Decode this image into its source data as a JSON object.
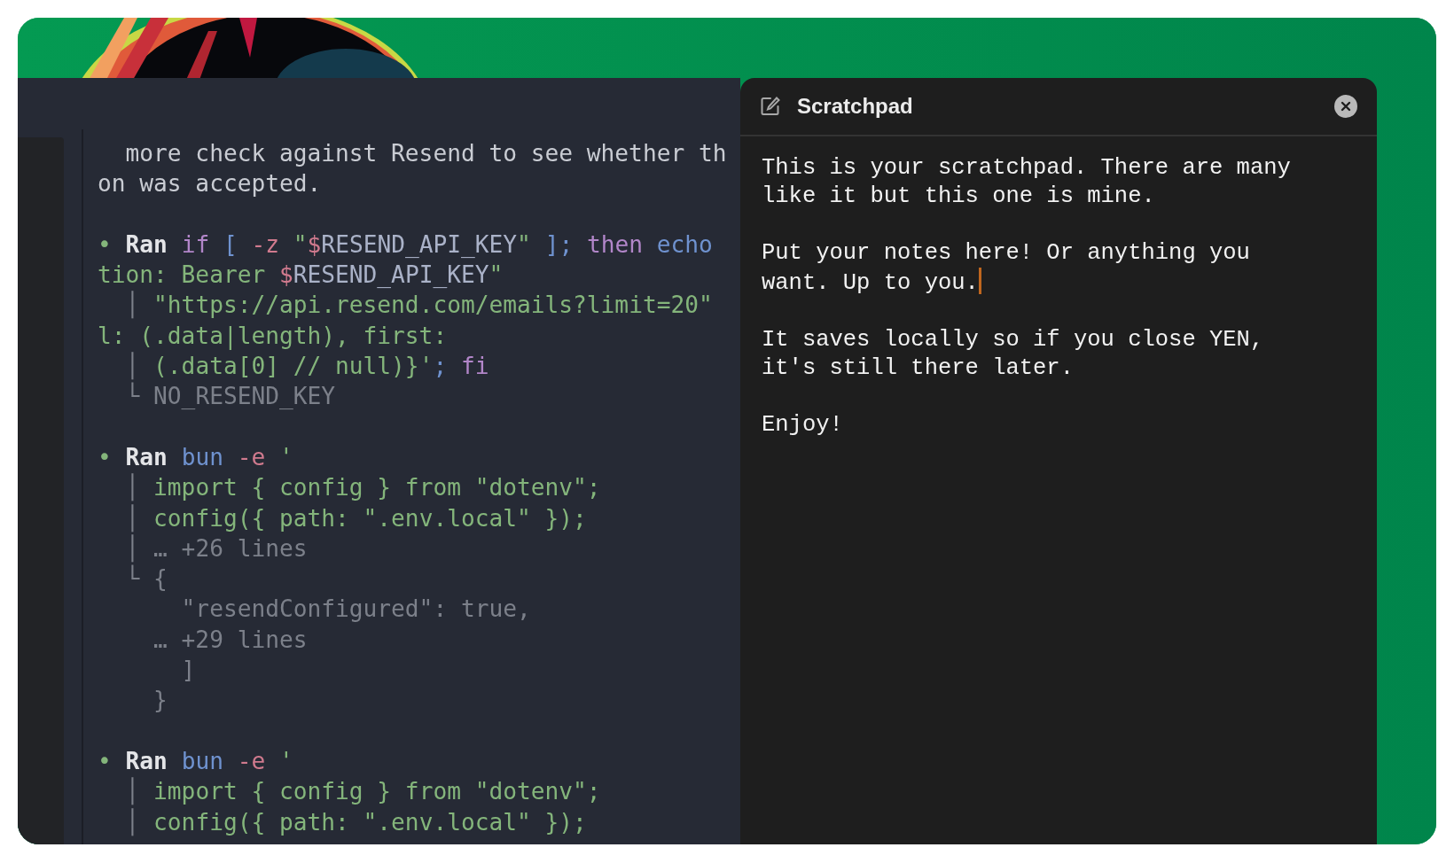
{
  "terminal": {
    "blocks": [
      {
        "lines": [
          {
            "segments": [
              {
                "text": "  more check against Resend to see whether th",
                "kind": "plain"
              }
            ]
          },
          {
            "segments": [
              {
                "text": "on was accepted.",
                "kind": "plain"
              }
            ]
          }
        ]
      },
      {
        "lines": [
          {
            "segments": [
              {
                "text": "• ",
                "kind": "bullet"
              },
              {
                "text": "Ran ",
                "kind": "bold"
              },
              {
                "text": "if ",
                "kind": "keyword"
              },
              {
                "text": "[ ",
                "kind": "builtin"
              },
              {
                "text": "-z ",
                "kind": "flag"
              },
              {
                "text": "\"",
                "kind": "string"
              },
              {
                "text": "$",
                "kind": "flag"
              },
              {
                "text": "RESEND_API_KEY",
                "kind": "variable"
              },
              {
                "text": "\" ",
                "kind": "string"
              },
              {
                "text": "]",
                "kind": "builtin"
              },
              {
                "text": "; ",
                "kind": "builtin"
              },
              {
                "text": "then ",
                "kind": "keyword"
              },
              {
                "text": "echo",
                "kind": "builtin"
              }
            ]
          },
          {
            "segments": [
              {
                "text": "tion: Bearer ",
                "kind": "string"
              },
              {
                "text": "$",
                "kind": "flag"
              },
              {
                "text": "RESEND_API_KEY",
                "kind": "variable"
              },
              {
                "text": "\"",
                "kind": "string"
              }
            ]
          },
          {
            "segments": [
              {
                "text": "  │ ",
                "kind": "gutter"
              },
              {
                "text": "\"https://api.resend.com/emails?limit=20\"",
                "kind": "string"
              }
            ]
          },
          {
            "segments": [
              {
                "text": "l: (.data|length), first:",
                "kind": "string"
              }
            ]
          },
          {
            "segments": [
              {
                "text": "  │ ",
                "kind": "gutter"
              },
              {
                "text": "(.data[0] // null)}'",
                "kind": "string"
              },
              {
                "text": "; ",
                "kind": "builtin"
              },
              {
                "text": "fi",
                "kind": "keyword"
              }
            ]
          },
          {
            "segments": [
              {
                "text": "  └ ",
                "kind": "gutter"
              },
              {
                "text": "NO_RESEND_KEY",
                "kind": "dim"
              }
            ]
          }
        ]
      },
      {
        "lines": [
          {
            "segments": [
              {
                "text": "• ",
                "kind": "bullet"
              },
              {
                "text": "Ran ",
                "kind": "bold"
              },
              {
                "text": "bun ",
                "kind": "builtin"
              },
              {
                "text": "-e ",
                "kind": "flag"
              },
              {
                "text": "'",
                "kind": "string"
              }
            ]
          },
          {
            "segments": [
              {
                "text": "  │ ",
                "kind": "gutter"
              },
              {
                "text": "import { config } from \"dotenv\";",
                "kind": "string"
              }
            ]
          },
          {
            "segments": [
              {
                "text": "  │ ",
                "kind": "gutter"
              },
              {
                "text": "config({ path: \".env.local\" });",
                "kind": "string"
              }
            ]
          },
          {
            "segments": [
              {
                "text": "  │ ",
                "kind": "gutter"
              },
              {
                "text": "… +26 lines",
                "kind": "dim"
              }
            ]
          },
          {
            "segments": [
              {
                "text": "  └ ",
                "kind": "gutter"
              },
              {
                "text": "{",
                "kind": "dim"
              }
            ]
          },
          {
            "segments": [
              {
                "text": "      \"resendConfigured\": true,",
                "kind": "dim"
              }
            ]
          },
          {
            "segments": [
              {
                "text": "    … +29 lines",
                "kind": "dim"
              }
            ]
          },
          {
            "segments": [
              {
                "text": "      ]",
                "kind": "dim"
              }
            ]
          },
          {
            "segments": [
              {
                "text": "    }",
                "kind": "dim"
              }
            ]
          }
        ]
      },
      {
        "lines": [
          {
            "segments": [
              {
                "text": "• ",
                "kind": "bullet"
              },
              {
                "text": "Ran ",
                "kind": "bold"
              },
              {
                "text": "bun ",
                "kind": "builtin"
              },
              {
                "text": "-e ",
                "kind": "flag"
              },
              {
                "text": "'",
                "kind": "string"
              }
            ]
          },
          {
            "segments": [
              {
                "text": "  │ ",
                "kind": "gutter"
              },
              {
                "text": "import { config } from \"dotenv\";",
                "kind": "string"
              }
            ]
          },
          {
            "segments": [
              {
                "text": "  │ ",
                "kind": "gutter"
              },
              {
                "text": "config({ path: \".env.local\" });",
                "kind": "string"
              }
            ]
          }
        ]
      }
    ]
  },
  "scratchpad": {
    "title": "Scratchpad",
    "paragraphs": [
      {
        "text": "This is your scratchpad. There are many\nlike it but this one is mine.",
        "caret": false
      },
      {
        "text": "Put your notes here! Or anything you\nwant. Up to you.",
        "caret": true
      },
      {
        "text": "It saves locally so if you close YEN,\nit's still there later.",
        "caret": false
      },
      {
        "text": "Enjoy!",
        "caret": false
      }
    ]
  }
}
